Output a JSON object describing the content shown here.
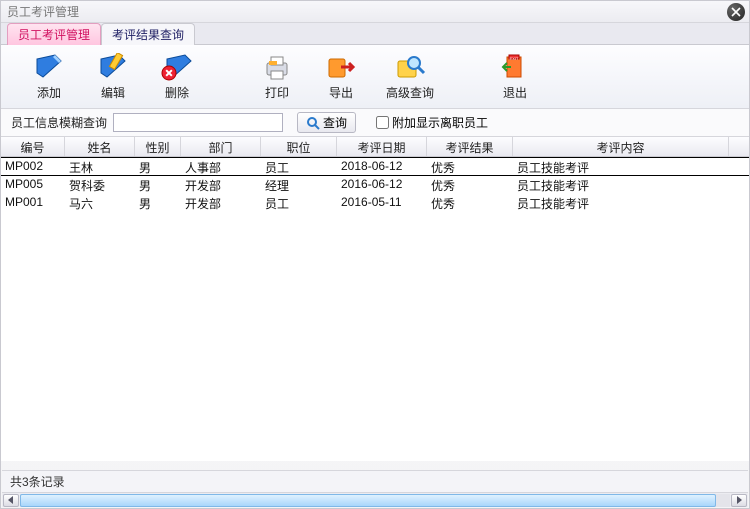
{
  "window": {
    "title": "员工考评管理"
  },
  "tabs": [
    {
      "label": "员工考评管理",
      "active": true
    },
    {
      "label": "考评结果查询",
      "active": false
    }
  ],
  "toolbar": {
    "add": "添加",
    "edit": "编辑",
    "delete": "删除",
    "print": "打印",
    "export": "导出",
    "advanced": "高级查询",
    "exit": "退出"
  },
  "search": {
    "label": "员工信息模糊查询",
    "value": "",
    "query_btn": "查询",
    "cb_label": "附加显示离职员工",
    "cb_checked": false
  },
  "columns": [
    "编号",
    "姓名",
    "性别",
    "部门",
    "职位",
    "考评日期",
    "考评结果",
    "考评内容"
  ],
  "rows": [
    {
      "id": "MP002",
      "name": "王林",
      "gender": "男",
      "dept": "人事部",
      "pos": "员工",
      "date": "2018-06-12",
      "result": "优秀",
      "content": "员工技能考评",
      "selected": true
    },
    {
      "id": "MP005",
      "name": "贺科委",
      "gender": "男",
      "dept": "开发部",
      "pos": "经理",
      "date": "2016-06-12",
      "result": "优秀",
      "content": "员工技能考评",
      "selected": false
    },
    {
      "id": "MP001",
      "name": "马六",
      "gender": "男",
      "dept": "开发部",
      "pos": "员工",
      "date": "2016-05-11",
      "result": "优秀",
      "content": "员工技能考评",
      "selected": false
    }
  ],
  "status": "共3条记录"
}
